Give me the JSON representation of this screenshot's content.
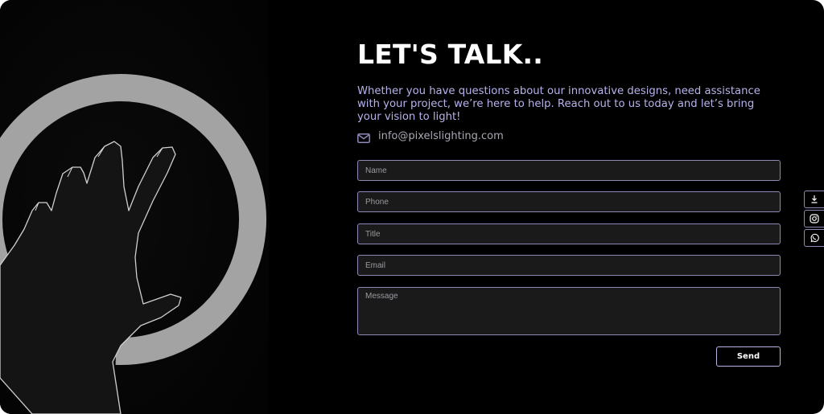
{
  "page": {
    "title": "LET'S TALK..",
    "intro": "Whether you have questions about our innovative designs, need assistance with your project, we’re here to help. Reach out to us today and let’s bring your vision to light!"
  },
  "contact": {
    "icon": "mail-icon",
    "email": "info@pixelslighting.com"
  },
  "form": {
    "name_placeholder": "Name",
    "phone_placeholder": "Phone",
    "title_placeholder": "Title",
    "email_placeholder": "Email",
    "message_placeholder": "Message",
    "send_label": "Send"
  },
  "floating_bar": {
    "items": [
      "download-icon",
      "instagram-icon",
      "whatsapp-icon"
    ]
  },
  "colors": {
    "background": "#000000",
    "accent": "#8e8ab8",
    "intro_text": "#b6b3ec",
    "ring": "#a3a3a3"
  }
}
